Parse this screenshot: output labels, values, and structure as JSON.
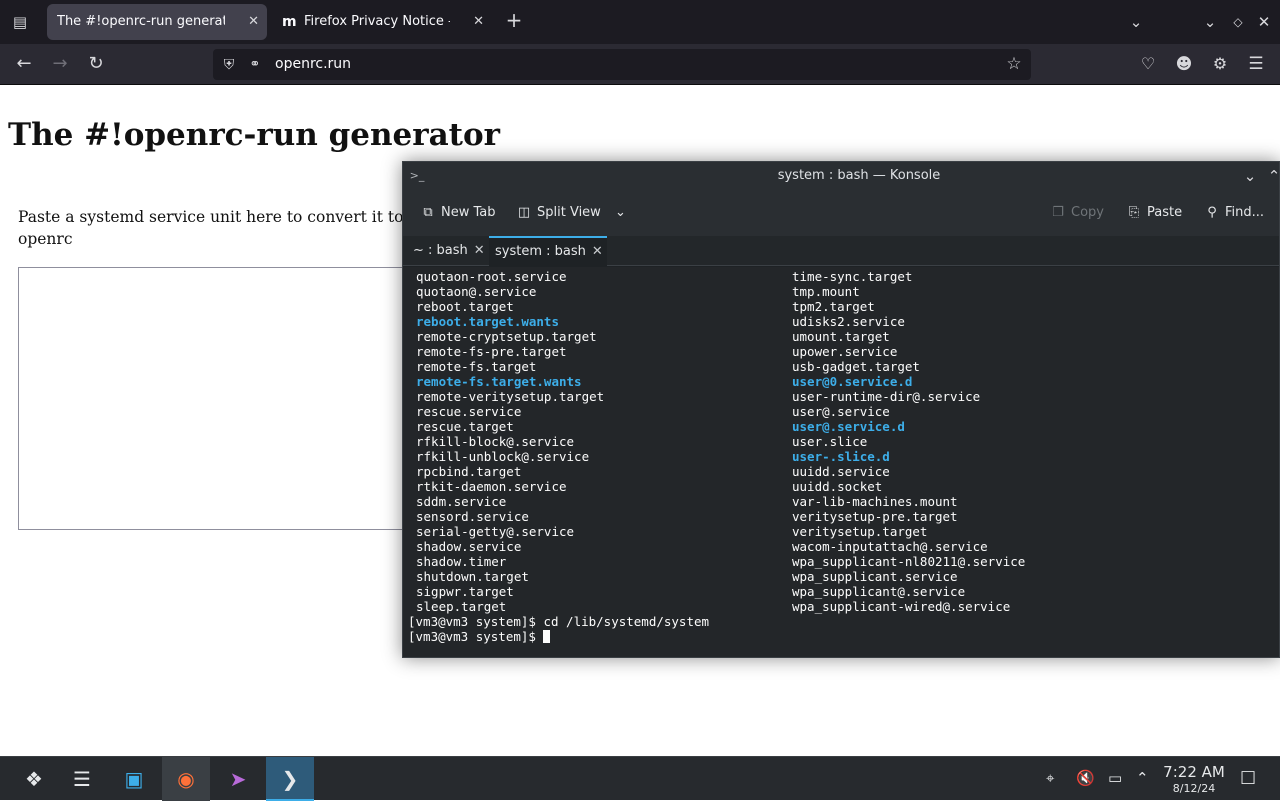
{
  "browser": {
    "tabs": [
      {
        "title": "The #!openrc-run generator"
      },
      {
        "title": "Firefox Privacy Notice — M"
      }
    ],
    "new_tab_symbol": "+",
    "url": "openrc.run",
    "icons": [
      "tab-overview-icon",
      "back-icon",
      "forward-icon",
      "reload-icon",
      "shield-icon",
      "lock-icon",
      "bookmark-star-icon",
      "pocket-icon",
      "account-icon",
      "extensions-icon",
      "menu-icon"
    ]
  },
  "page": {
    "title": "The #!openrc-run generator",
    "instruction": "Paste a systemd service unit here to convert it to openrc",
    "textarea_value": ""
  },
  "konsole": {
    "title": "system : bash — Konsole",
    "toolbar": {
      "new_tab": "New Tab",
      "split_view": "Split View",
      "copy": "Copy",
      "paste": "Paste",
      "find": "Find..."
    },
    "tabs": [
      {
        "label": "~ : bash"
      },
      {
        "label": "system : bash"
      }
    ],
    "listing": [
      {
        "left": "quotaon-root.service",
        "left_dir": false,
        "right": "time-sync.target",
        "right_dir": false
      },
      {
        "left": "quotaon@.service",
        "left_dir": false,
        "right": "tmp.mount",
        "right_dir": false
      },
      {
        "left": "reboot.target",
        "left_dir": false,
        "right": "tpm2.target",
        "right_dir": false
      },
      {
        "left": "reboot.target.wants",
        "left_dir": true,
        "right": "udisks2.service",
        "right_dir": false
      },
      {
        "left": "remote-cryptsetup.target",
        "left_dir": false,
        "right": "umount.target",
        "right_dir": false
      },
      {
        "left": "remote-fs-pre.target",
        "left_dir": false,
        "right": "upower.service",
        "right_dir": false
      },
      {
        "left": "remote-fs.target",
        "left_dir": false,
        "right": "usb-gadget.target",
        "right_dir": false
      },
      {
        "left": "remote-fs.target.wants",
        "left_dir": true,
        "right": "user@0.service.d",
        "right_dir": true
      },
      {
        "left": "remote-veritysetup.target",
        "left_dir": false,
        "right": "user-runtime-dir@.service",
        "right_dir": false
      },
      {
        "left": "rescue.service",
        "left_dir": false,
        "right": "user@.service",
        "right_dir": false
      },
      {
        "left": "rescue.target",
        "left_dir": false,
        "right": "user@.service.d",
        "right_dir": true
      },
      {
        "left": "rfkill-block@.service",
        "left_dir": false,
        "right": "user.slice",
        "right_dir": false
      },
      {
        "left": "rfkill-unblock@.service",
        "left_dir": false,
        "right": "user-.slice.d",
        "right_dir": true
      },
      {
        "left": "rpcbind.target",
        "left_dir": false,
        "right": "uuidd.service",
        "right_dir": false
      },
      {
        "left": "rtkit-daemon.service",
        "left_dir": false,
        "right": "uuidd.socket",
        "right_dir": false
      },
      {
        "left": "sddm.service",
        "left_dir": false,
        "right": "var-lib-machines.mount",
        "right_dir": false
      },
      {
        "left": "sensord.service",
        "left_dir": false,
        "right": "veritysetup-pre.target",
        "right_dir": false
      },
      {
        "left": "serial-getty@.service",
        "left_dir": false,
        "right": "veritysetup.target",
        "right_dir": false
      },
      {
        "left": "shadow.service",
        "left_dir": false,
        "right": "wacom-inputattach@.service",
        "right_dir": false
      },
      {
        "left": "shadow.timer",
        "left_dir": false,
        "right": "wpa_supplicant-nl80211@.service",
        "right_dir": false
      },
      {
        "left": "shutdown.target",
        "left_dir": false,
        "right": "wpa_supplicant.service",
        "right_dir": false
      },
      {
        "left": "sigpwr.target",
        "left_dir": false,
        "right": "wpa_supplicant@.service",
        "right_dir": false
      },
      {
        "left": "sleep.target",
        "left_dir": false,
        "right": "wpa_supplicant-wired@.service",
        "right_dir": false
      }
    ],
    "prompt_lines": [
      "[vm3@vm3 system]$ cd /lib/systemd/system",
      "[vm3@vm3 system]$ "
    ],
    "directory_color": "#3daee9"
  },
  "taskbar": {
    "apps": [
      "launcher-icon",
      "system-settings-icon",
      "discover-store-icon",
      "firefox-icon",
      "kdeconnect-icon",
      "konsole-icon"
    ],
    "tray": [
      "network-icon",
      "volume-muted-icon",
      "display-icon",
      "tray-expand-icon"
    ],
    "time": "7:22 AM",
    "date": "8/12/24"
  }
}
